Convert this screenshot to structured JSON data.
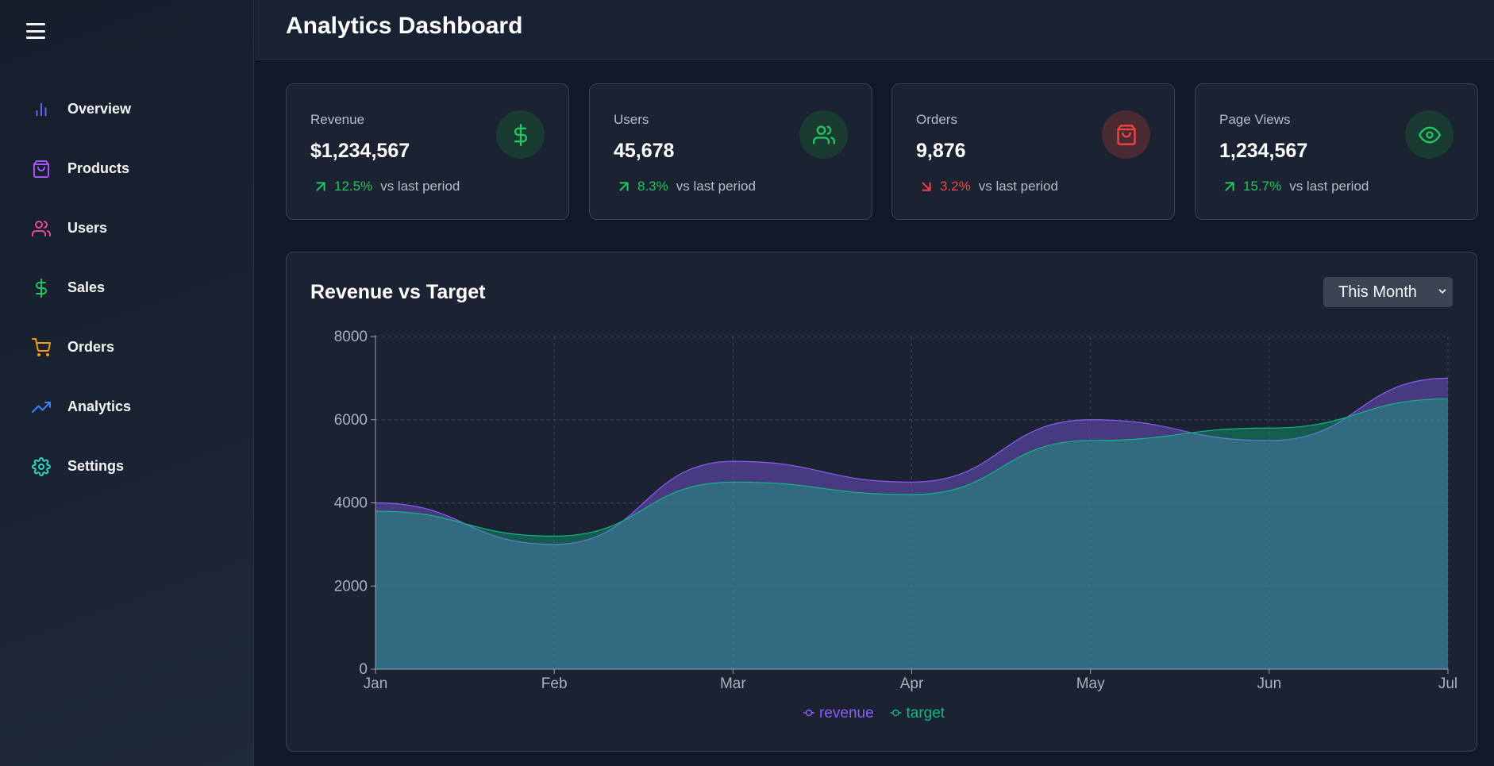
{
  "sidebar": {
    "items": [
      {
        "label": "Overview",
        "icon": "bar-chart-icon",
        "color": "#6366f1"
      },
      {
        "label": "Products",
        "icon": "shopping-bag-icon",
        "color": "#a855f7"
      },
      {
        "label": "Users",
        "icon": "users-icon",
        "color": "#ec4899"
      },
      {
        "label": "Sales",
        "icon": "dollar-icon",
        "color": "#22c55e"
      },
      {
        "label": "Orders",
        "icon": "shopping-cart-icon",
        "color": "#f59e0b"
      },
      {
        "label": "Analytics",
        "icon": "trending-up-icon",
        "color": "#3b82f6"
      },
      {
        "label": "Settings",
        "icon": "gear-icon",
        "color": "#2dd4bf"
      }
    ]
  },
  "header": {
    "title": "Analytics Dashboard"
  },
  "stats": [
    {
      "label": "Revenue",
      "value": "$1,234,567",
      "change": "12.5%",
      "direction": "up",
      "compare": "vs last period",
      "icon": "dollar-icon",
      "color": "#22c55e"
    },
    {
      "label": "Users",
      "value": "45,678",
      "change": "8.3%",
      "direction": "up",
      "compare": "vs last period",
      "icon": "users-icon",
      "color": "#22c55e"
    },
    {
      "label": "Orders",
      "value": "9,876",
      "change": "3.2%",
      "direction": "down",
      "compare": "vs last period",
      "icon": "shopping-bag-icon",
      "color": "#ef4444"
    },
    {
      "label": "Page Views",
      "value": "1,234,567",
      "change": "15.7%",
      "direction": "up",
      "compare": "vs last period",
      "icon": "eye-icon",
      "color": "#22c55e"
    }
  ],
  "chart_panel": {
    "title": "Revenue vs Target",
    "period_selected": "This Month"
  },
  "chart_data": {
    "type": "area",
    "title": "Revenue vs Target",
    "categories": [
      "Jan",
      "Feb",
      "Mar",
      "Apr",
      "May",
      "Jun",
      "Jul"
    ],
    "series": [
      {
        "name": "revenue",
        "values": [
          4000,
          3000,
          5000,
          4500,
          6000,
          5500,
          7000
        ],
        "color": "#8b5cf6"
      },
      {
        "name": "target",
        "values": [
          3800,
          3200,
          4500,
          4200,
          5500,
          5800,
          6500
        ],
        "color": "#10b981"
      }
    ],
    "yticks": [
      0,
      2000,
      4000,
      6000,
      8000
    ],
    "ylim": [
      0,
      8000
    ],
    "grid": true,
    "legend": "bottom-center"
  }
}
